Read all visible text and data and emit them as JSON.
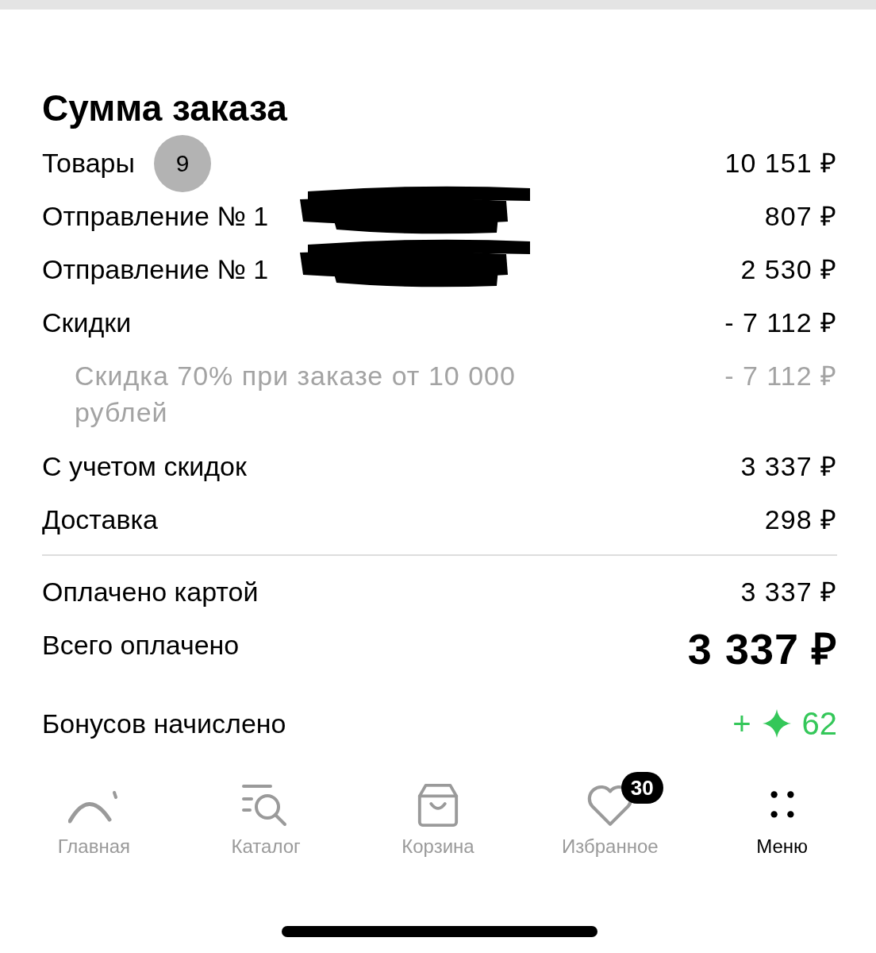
{
  "title": "Сумма заказа",
  "rows": [
    {
      "kind": "normal",
      "label": "Товары",
      "count": "9",
      "value": "10 151 ₽"
    },
    {
      "kind": "normal",
      "label": "Отправление № 1",
      "value": "807 ₽",
      "redacted": true
    },
    {
      "kind": "normal",
      "label": "Отправление № 1",
      "value": "2 530 ₽",
      "redacted": true
    },
    {
      "kind": "normal",
      "label": "Скидки",
      "value": "- 7 112 ₽"
    },
    {
      "kind": "sub",
      "label": "Скидка 70% при заказе от 10 000 рублей",
      "value": "- 7 112 ₽"
    },
    {
      "kind": "normal",
      "label": "С учетом скидок",
      "value": "3 337 ₽"
    },
    {
      "kind": "normal",
      "label": "Доставка",
      "value": "298 ₽"
    },
    {
      "kind": "divider"
    },
    {
      "kind": "normal",
      "label": "Оплачено картой",
      "value": "3 337 ₽"
    },
    {
      "kind": "total",
      "label": "Всего оплачено",
      "value": "3 337 ₽"
    },
    {
      "kind": "bonus",
      "label": "Бонусов начислено",
      "sign": "+",
      "value": "62"
    }
  ],
  "tabs": [
    {
      "label": "Главная",
      "selected": false
    },
    {
      "label": "Каталог",
      "selected": false
    },
    {
      "label": "Корзина",
      "selected": false
    },
    {
      "label": "Избранное",
      "selected": false,
      "badge": "30"
    },
    {
      "label": "Меню",
      "selected": true
    }
  ]
}
